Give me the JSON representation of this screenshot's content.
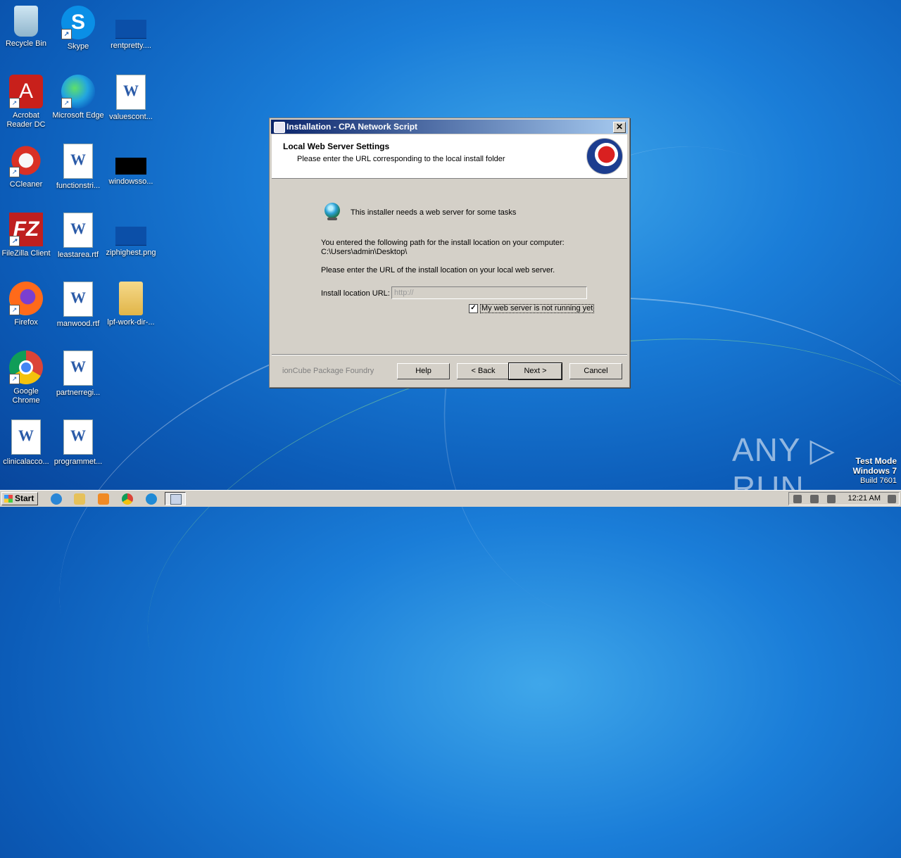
{
  "desktop": {
    "icons": [
      {
        "label": "Recycle Bin"
      },
      {
        "label": "Skype"
      },
      {
        "label": "rentpretty...."
      },
      {
        "label": "Acrobat Reader DC"
      },
      {
        "label": "Microsoft Edge"
      },
      {
        "label": "valuescont..."
      },
      {
        "label": "CCleaner"
      },
      {
        "label": "functionstri..."
      },
      {
        "label": "windowsso..."
      },
      {
        "label": "FileZilla Client"
      },
      {
        "label": "leastarea.rtf"
      },
      {
        "label": "ziphighest.png"
      },
      {
        "label": "Firefox"
      },
      {
        "label": "manwood.rtf"
      },
      {
        "label": "lpf-work-dir-..."
      },
      {
        "label": "Google Chrome"
      },
      {
        "label": "partnerregi..."
      },
      {
        "label": "clinicalacco..."
      },
      {
        "label": "programmet..."
      }
    ]
  },
  "dialog": {
    "title": "Installation - CPA Network Script",
    "close_glyph": "✕",
    "header_title": "Local Web Server Settings",
    "header_subtitle": "Please enter the URL corresponding to the local install folder",
    "info_text": "This installer needs a web server for some tasks",
    "path_intro": "You entered the following path for the install location on your computer:",
    "path_value": "C:\\Users\\admin\\Desktop\\",
    "url_prompt": "Please enter the URL of the install location on your local web server.",
    "url_label": "Install location URL:",
    "url_value": "http://",
    "checkbox_label": "My web server is not running yet",
    "checkbox_checked": true,
    "checkbox_glyph": "✓",
    "brand": "ionCube Package Foundry",
    "buttons": {
      "help": "Help",
      "back": "< Back",
      "next": "Next >",
      "cancel": "Cancel"
    }
  },
  "taskbar": {
    "start_label": "Start",
    "clock": "12:21 AM"
  },
  "watermark": {
    "brand": "ANY ▷ RUN",
    "test_mode": "Test Mode",
    "os": "Windows 7",
    "build": "Build 7601"
  }
}
